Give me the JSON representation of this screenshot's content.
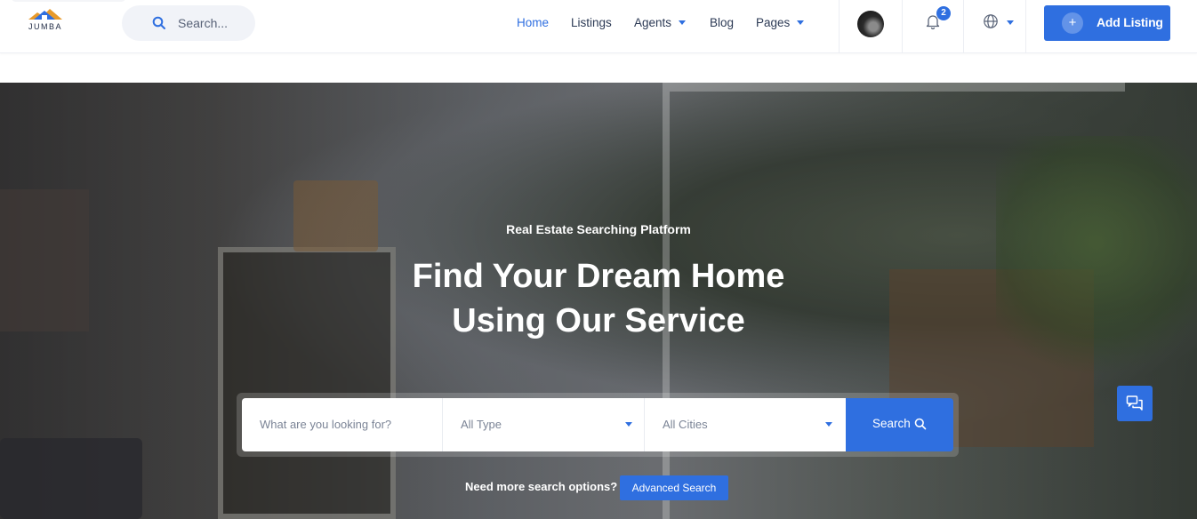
{
  "brand": {
    "logo_text": "JUMBA"
  },
  "search": {
    "placeholder": "Search..."
  },
  "nav": [
    {
      "label": "Home",
      "active": true
    },
    {
      "label": "Listings"
    },
    {
      "label": "Agents",
      "dropdown": true
    },
    {
      "label": "Blog"
    },
    {
      "label": "Pages",
      "dropdown": true
    }
  ],
  "notifications": {
    "count": "2"
  },
  "add_listing": {
    "label": "Add Listing",
    "icon": "+"
  },
  "hero": {
    "subtitle": "Real Estate Searching Platform",
    "title_line1": "Find Your Dream Home",
    "title_line2": "Using Our Service"
  },
  "search_bar": {
    "keyword_placeholder": "What are you looking for?",
    "type_value": "All Type",
    "city_value": "All Cities",
    "button_label": "Search"
  },
  "advanced": {
    "prompt": "Need more search options?",
    "button_label": "Advanced Search"
  },
  "colors": {
    "accent": "#2f6fe0",
    "text_dark": "#2c3a55"
  },
  "icons": [
    "search-icon",
    "bell-icon",
    "globe-icon",
    "plus-icon",
    "chat-icon"
  ]
}
